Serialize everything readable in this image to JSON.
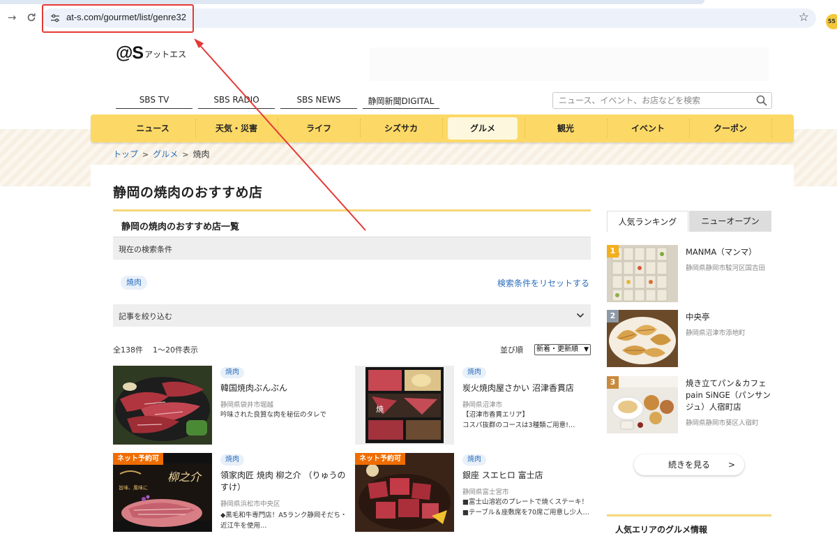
{
  "browser": {
    "url": "at-s.com/gourmet/list/genre32",
    "extension_badge": "55"
  },
  "header": {
    "logo_mark": "@S",
    "logo_kana": "アットエス",
    "service_links": [
      "SBS TV",
      "SBS RADIO",
      "SBS NEWS",
      "静岡新聞DIGITAL"
    ],
    "search_placeholder": "ニュース、イベント、お店などを検索"
  },
  "nav": {
    "items": [
      "ニュース",
      "天気・災害",
      "ライフ",
      "シズサカ",
      "グルメ",
      "観光",
      "イベント",
      "クーポン"
    ],
    "active": "グルメ",
    "accent_color": "#fcd966"
  },
  "breadcrumb": {
    "items": [
      "トップ",
      "グルメ"
    ],
    "current": "焼肉"
  },
  "main": {
    "title": "静岡の焼肉のおすすめ店",
    "section_title": "静岡の焼肉のおすすめ店一覧",
    "condition_label": "現在の検索条件",
    "condition_tag": "焼肉",
    "reset_link": "検索条件をリセットする",
    "filter_label": "記事を絞り込む",
    "result_total": "全138件",
    "result_range": "1〜20件表示",
    "sort_label": "並び順",
    "sort_value": "新着・更新順"
  },
  "cards": [
    {
      "badge": "",
      "tag": "焼肉",
      "name": "韓国焼肉ぶんぶん",
      "area": "静岡県袋井市堀越",
      "desc": [
        "吟味された良質な肉を秘伝のタレで"
      ]
    },
    {
      "badge": "",
      "tag": "焼肉",
      "name": "炭火焼肉屋さかい 沼津香貫店",
      "area": "静岡県沼津市",
      "desc": [
        "【沼津市香貫エリア】",
        "コスパ抜群のコースは3種類ご用意!…"
      ]
    },
    {
      "badge": "ネット予約可",
      "tag": "焼肉",
      "name": "領家肉匠 焼肉 柳之介 （りゅうのすけ）",
      "area": "静岡県浜松市中央区",
      "desc": [
        "◆黒毛和牛専門店！A5ランク静岡そだち・",
        "近江牛を使用…"
      ]
    },
    {
      "badge": "ネット予約可",
      "tag": "焼肉",
      "name": "銀座 スエヒロ 富士店",
      "area": "静岡県富士宮市",
      "desc": [
        "■富士山溶岩のプレートで焼くステーキ！",
        "■テーブル＆座敷席を70席ご用意し少人…"
      ]
    }
  ],
  "sidebar": {
    "tabs": [
      "人気ランキング",
      "ニューオープン"
    ],
    "ranking": [
      {
        "rank": "1",
        "name": "MANMA（マンマ）",
        "area": "静岡県静岡市駿河区国吉田",
        "color": "#f2b01e"
      },
      {
        "rank": "2",
        "name": "中央亭",
        "area": "静岡県沼津市添地町",
        "color": "#8e9aa7"
      },
      {
        "rank": "3",
        "name": "焼き立てパン＆カフェ pain SiNGE（パンサンジュ）人宿町店",
        "area": "静岡県静岡市葵区人宿町",
        "color": "#c98a3d"
      }
    ],
    "more_label": "続きを見る",
    "area_title": "人気エリアのグルメ情報"
  }
}
